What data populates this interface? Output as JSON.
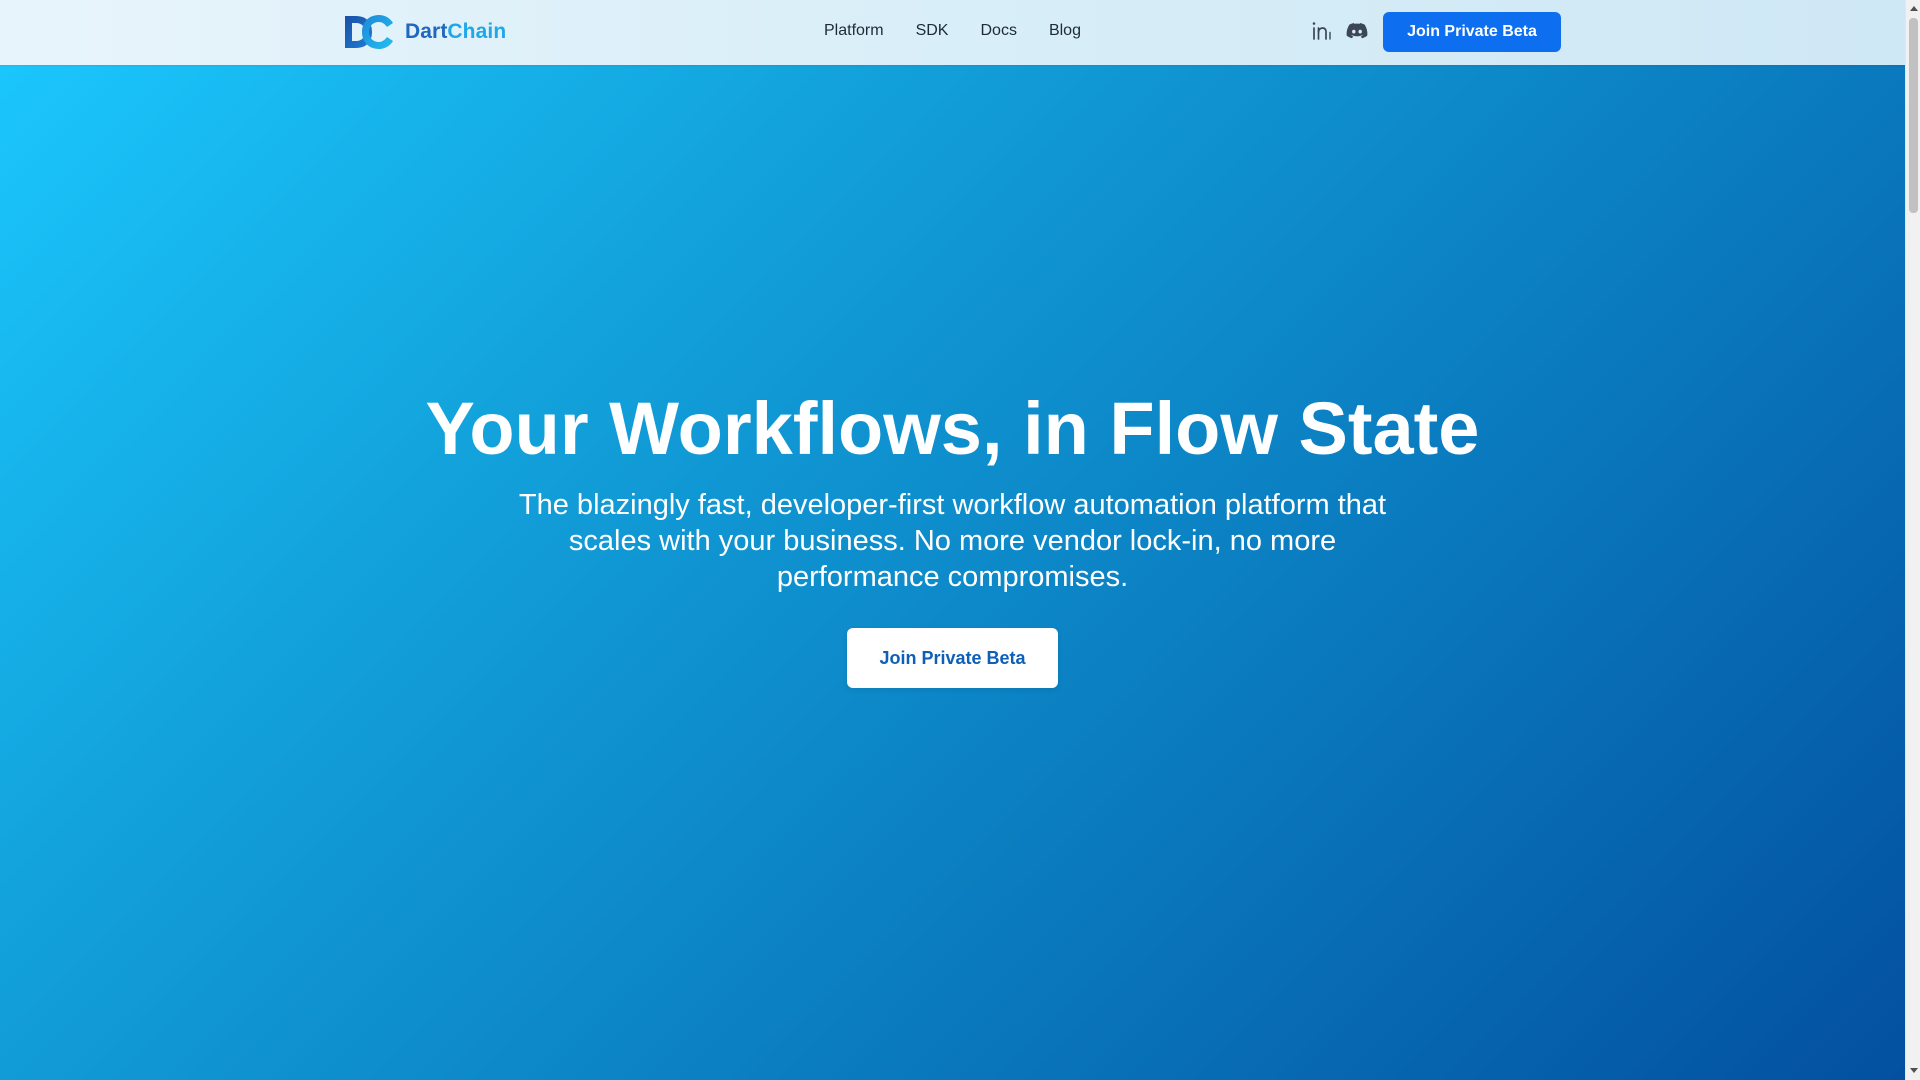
{
  "brand": {
    "name_part1": "Dart",
    "name_part2": "Chain",
    "logo_icon": "dc-logo-icon"
  },
  "nav": {
    "items": [
      {
        "label": "Platform"
      },
      {
        "label": "SDK"
      },
      {
        "label": "Docs"
      },
      {
        "label": "Blog"
      }
    ]
  },
  "social": {
    "icons": [
      "linkedin-icon",
      "discord-icon"
    ]
  },
  "header": {
    "cta_label": "Join Private Beta"
  },
  "hero": {
    "title": "Your Workflows, in Flow State",
    "subtitle": "The blazingly fast, developer-first workflow automation platform that scales with your business. No more vendor lock-in, no more performance compromises.",
    "cta_label": "Join Private Beta"
  },
  "colors": {
    "accent": "#0d6ef0",
    "brand_dark": "#1f67bf",
    "brand_light": "#1fa8e8",
    "hero_gradient_start": "#1bc9ff",
    "hero_gradient_end": "#0350a0"
  }
}
